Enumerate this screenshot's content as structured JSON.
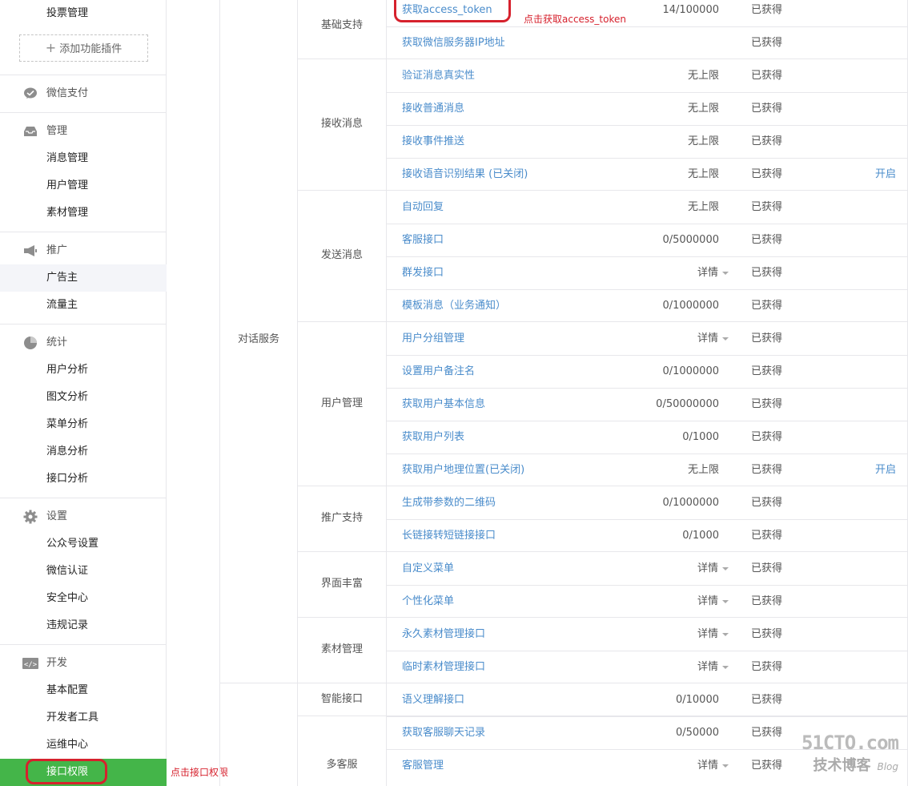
{
  "sidebar": {
    "vote_label": "投票管理",
    "add_plugin_label": "添加功能插件",
    "wechat_pay_label": "微信支付",
    "manage": {
      "title": "管理",
      "items": [
        "消息管理",
        "用户管理",
        "素材管理"
      ]
    },
    "promote": {
      "title": "推广",
      "items": [
        "广告主",
        "流量主"
      ]
    },
    "stats": {
      "title": "统计",
      "items": [
        "用户分析",
        "图文分析",
        "菜单分析",
        "消息分析",
        "接口分析"
      ]
    },
    "settings": {
      "title": "设置",
      "items": [
        "公众号设置",
        "微信认证",
        "安全中心",
        "违规记录"
      ]
    },
    "dev": {
      "title": "开发",
      "items": [
        "基本配置",
        "开发者工具",
        "运维中心",
        "接口权限"
      ]
    }
  },
  "annotations": {
    "token": "点击获取access_token",
    "permission": "点击接口权限"
  },
  "table": {
    "service_category": "对话服务",
    "groups": [
      {
        "name": "基础支持"
      },
      {
        "name": "接收消息"
      },
      {
        "name": "发送消息"
      },
      {
        "name": "用户管理"
      },
      {
        "name": "推广支持"
      },
      {
        "name": "界面丰富"
      },
      {
        "name": "素材管理"
      },
      {
        "name": "智能接口"
      },
      {
        "name": "多客服"
      }
    ],
    "rows": [
      {
        "name": "获取access_token",
        "quota": "14/100000",
        "status": "已获得",
        "action": ""
      },
      {
        "name": "获取微信服务器IP地址",
        "quota": "",
        "status": "已获得",
        "action": ""
      },
      {
        "name": "验证消息真实性",
        "quota": "无上限",
        "status": "已获得",
        "action": ""
      },
      {
        "name": "接收普通消息",
        "quota": "无上限",
        "status": "已获得",
        "action": ""
      },
      {
        "name": "接收事件推送",
        "quota": "无上限",
        "status": "已获得",
        "action": ""
      },
      {
        "name": "接收语音识别结果 (已关闭)",
        "quota": "无上限",
        "status": "已获得",
        "action": "开启"
      },
      {
        "name": "自动回复",
        "quota": "无上限",
        "status": "已获得",
        "action": ""
      },
      {
        "name": "客服接口",
        "quota": "0/5000000",
        "status": "已获得",
        "action": ""
      },
      {
        "name": "群发接口",
        "quota": "详情",
        "status": "已获得",
        "action": ""
      },
      {
        "name": "模板消息（业务通知）",
        "quota": "0/1000000",
        "status": "已获得",
        "action": ""
      },
      {
        "name": "用户分组管理",
        "quota": "详情",
        "status": "已获得",
        "action": ""
      },
      {
        "name": "设置用户备注名",
        "quota": "0/1000000",
        "status": "已获得",
        "action": ""
      },
      {
        "name": "获取用户基本信息",
        "quota": "0/50000000",
        "status": "已获得",
        "action": ""
      },
      {
        "name": "获取用户列表",
        "quota": "0/1000",
        "status": "已获得",
        "action": ""
      },
      {
        "name": "获取用户地理位置(已关闭)",
        "quota": "无上限",
        "status": "已获得",
        "action": "开启"
      },
      {
        "name": "生成带参数的二维码",
        "quota": "0/1000000",
        "status": "已获得",
        "action": ""
      },
      {
        "name": "长链接转短链接接口",
        "quota": "0/1000",
        "status": "已获得",
        "action": ""
      },
      {
        "name": "自定义菜单",
        "quota": "详情",
        "status": "已获得",
        "action": ""
      },
      {
        "name": "个性化菜单",
        "quota": "详情",
        "status": "已获得",
        "action": ""
      },
      {
        "name": "永久素材管理接口",
        "quota": "详情",
        "status": "已获得",
        "action": ""
      },
      {
        "name": "临时素材管理接口",
        "quota": "详情",
        "status": "已获得",
        "action": ""
      },
      {
        "name": "语义理解接口",
        "quota": "0/10000",
        "status": "已获得",
        "action": ""
      },
      {
        "name": "获取客服聊天记录",
        "quota": "0/50000",
        "status": "已获得",
        "action": ""
      },
      {
        "name": "客服管理",
        "quota": "详情",
        "status": "已获得",
        "action": ""
      }
    ]
  },
  "watermark": {
    "site": "51CTO.com",
    "sub": "技术博客",
    "blog": "Blog"
  }
}
